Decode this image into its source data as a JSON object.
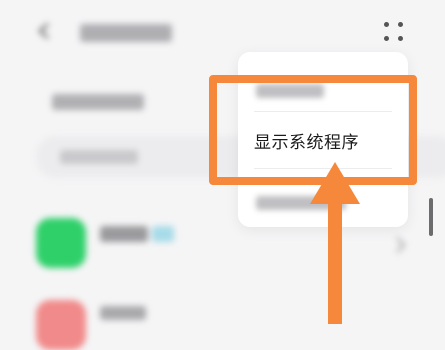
{
  "popup_menu": {
    "items": [
      {
        "label": ""
      },
      {
        "label": "显示系统程序"
      },
      {
        "label": ""
      }
    ]
  },
  "toolbar": {
    "more_icon": "more-dots-icon",
    "back_icon": "back-arrow-icon"
  },
  "colors": {
    "annotation": "#f5883a",
    "app_icon_green": "#2fd06a",
    "app_icon_red": "#f18a8a",
    "popup_bg": "#ffffff",
    "page_bg": "#f5f5f6"
  }
}
